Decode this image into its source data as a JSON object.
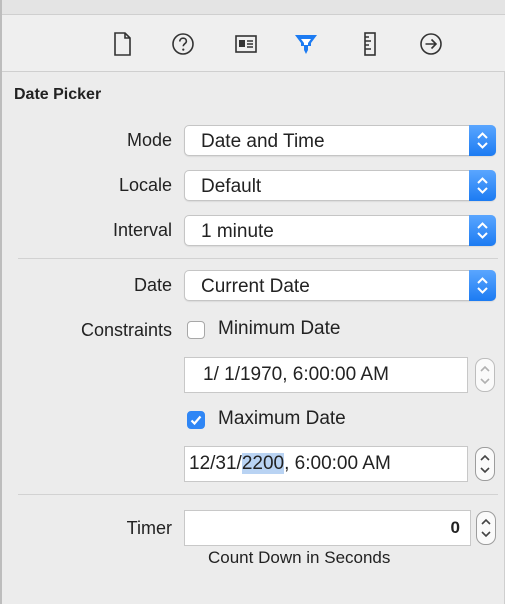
{
  "toolbar": {
    "icons": [
      "file-icon",
      "help-icon",
      "identity-icon",
      "attributes-icon",
      "size-ruler-icon",
      "connections-icon"
    ],
    "accent": "#1c7bf2"
  },
  "section": {
    "title": "Date Picker"
  },
  "mode": {
    "label": "Mode",
    "value": "Date and Time"
  },
  "locale": {
    "label": "Locale",
    "value": "Default"
  },
  "interval": {
    "label": "Interval",
    "value": "1 minute"
  },
  "date": {
    "label": "Date",
    "value": "Current Date"
  },
  "constraints": {
    "label": "Constraints",
    "minimum": {
      "label": "Minimum Date",
      "checked": false,
      "value": "1/ 1/1970,   6:00:00 AM"
    },
    "maximum": {
      "label": "Maximum Date",
      "checked": true,
      "value_before": "12/31/",
      "value_selected": "2200",
      "value_after": ",   6:00:00 AM"
    }
  },
  "timer": {
    "label": "Timer",
    "value": "0",
    "caption": "Count Down in Seconds"
  }
}
